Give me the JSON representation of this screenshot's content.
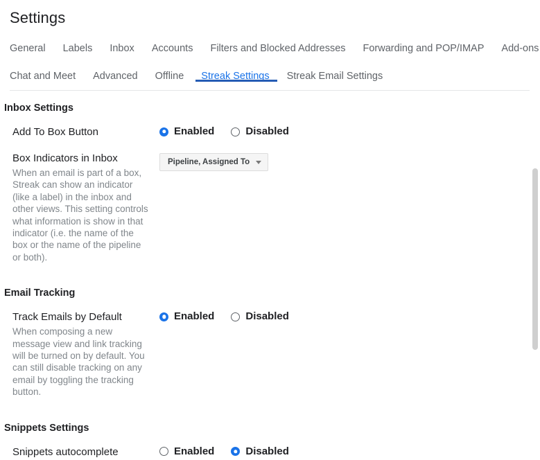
{
  "page": {
    "title": "Settings"
  },
  "tabs": {
    "row1": [
      {
        "label": "General",
        "active": false
      },
      {
        "label": "Labels",
        "active": false
      },
      {
        "label": "Inbox",
        "active": false
      },
      {
        "label": "Accounts",
        "active": false
      },
      {
        "label": "Filters and Blocked Addresses",
        "active": false
      },
      {
        "label": "Forwarding and POP/IMAP",
        "active": false
      },
      {
        "label": "Add-ons",
        "active": false
      }
    ],
    "row2": [
      {
        "label": "Chat and Meet",
        "active": false
      },
      {
        "label": "Advanced",
        "active": false
      },
      {
        "label": "Offline",
        "active": false
      },
      {
        "label": "Streak Settings",
        "active": true
      },
      {
        "label": "Streak Email Settings",
        "active": false
      }
    ],
    "active_tab": "Streak Settings",
    "active_color": "#1a73e8",
    "underline_color": "#255cb4"
  },
  "sections": {
    "inbox": {
      "heading": "Inbox Settings",
      "add_to_box": {
        "label": "Add To Box Button",
        "enabled_label": "Enabled",
        "disabled_label": "Disabled",
        "selected": "Enabled"
      },
      "box_indicators": {
        "label": "Box Indicators in Inbox",
        "description": "When an email is part of a box, Streak can show an indicator (like a label) in the inbox and other views. This setting controls what information is show in that indicator (i.e. the name of the box or the name of the pipeline or both).",
        "dropdown_value": "Pipeline, Assigned To"
      }
    },
    "email_tracking": {
      "heading": "Email Tracking",
      "track_emails": {
        "label": "Track Emails by Default",
        "description": "When composing a new message view and link tracking will be turned on by default. You can still disable tracking on any email by toggling the tracking button.",
        "enabled_label": "Enabled",
        "disabled_label": "Disabled",
        "selected": "Enabled"
      }
    },
    "snippets": {
      "heading": "Snippets Settings",
      "autocomplete": {
        "label": "Snippets autocomplete",
        "enabled_label": "Enabled",
        "disabled_label": "Disabled",
        "selected": "Disabled"
      }
    }
  },
  "colors": {
    "accent": "#1a73e8",
    "text": "#202124",
    "muted": "#80868b",
    "divider": "#e4e6e8"
  }
}
